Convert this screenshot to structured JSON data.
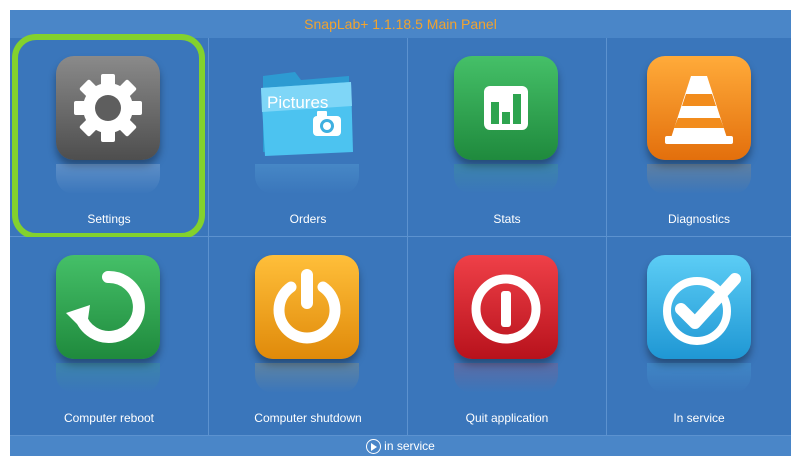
{
  "window": {
    "title": "SnapLab+ 1.1.18.5 Main Panel"
  },
  "tiles": [
    {
      "label": "Settings",
      "icon": "gear-icon",
      "color": "#6b6b6b",
      "selected": true
    },
    {
      "label": "Orders",
      "icon": "pictures-folder-icon",
      "color": "#3fb9e8"
    },
    {
      "label": "Stats",
      "icon": "bar-chart-icon",
      "color": "#2ea44f"
    },
    {
      "label": "Diagnostics",
      "icon": "traffic-cone-icon",
      "color": "#f08a18"
    },
    {
      "label": "Computer reboot",
      "icon": "reboot-icon",
      "color": "#2ea44f"
    },
    {
      "label": "Computer shutdown",
      "icon": "power-icon",
      "color": "#f2a112"
    },
    {
      "label": "Quit application",
      "icon": "quit-icon",
      "color": "#d8222d"
    },
    {
      "label": "In service",
      "icon": "checkmark-icon",
      "color": "#3fb9e8"
    }
  ],
  "status": {
    "text": "in service",
    "icon": "play-circle-icon"
  },
  "orders_icon_text": "Pictures",
  "colors": {
    "frame": "#3b77bc",
    "title_text": "#f0a330",
    "selection": "#83d12d"
  }
}
